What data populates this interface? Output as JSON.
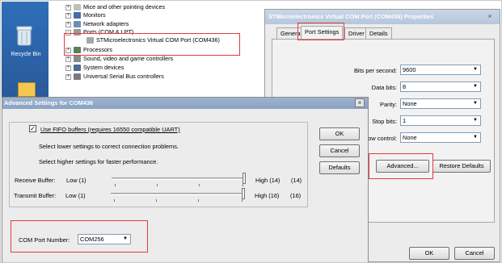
{
  "desktop": {
    "recycle_bin": "Recycle Bin"
  },
  "device_tree": {
    "items": [
      {
        "label": "Mice and other pointing devices",
        "expand": "+"
      },
      {
        "label": "Monitors",
        "expand": "+"
      },
      {
        "label": "Network adapters",
        "expand": "+"
      },
      {
        "label": "Ports (COM & LPT)",
        "expand": "-"
      },
      {
        "label": "STMicroelectronics Virtual COM Port (COM436)",
        "expand": ""
      },
      {
        "label": "Processors",
        "expand": "+"
      },
      {
        "label": "Sound, video and game controllers",
        "expand": "+"
      },
      {
        "label": "System devices",
        "expand": "+"
      },
      {
        "label": "Universal Serial Bus controllers",
        "expand": "+"
      }
    ]
  },
  "properties": {
    "title": "STMicroelectronics Virtual COM Port (COM436) Properties",
    "tabs": [
      "General",
      "Port Settings",
      "Driver",
      "Details"
    ],
    "active_tab": "Port Settings",
    "fields": [
      {
        "label": "Bits per second:",
        "value": "9600"
      },
      {
        "label": "Data bits:",
        "value": "8"
      },
      {
        "label": "Parity:",
        "value": "None"
      },
      {
        "label": "Stop bits:",
        "value": "1"
      },
      {
        "label": "Flow control:",
        "value": "None"
      }
    ],
    "advanced_button": "Advanced...",
    "restore_button": "Restore Defaults",
    "ok_button": "OK",
    "cancel_button": "Cancel"
  },
  "advanced": {
    "title": "Advanced Settings for COM436",
    "fifo_checked": true,
    "fifo_label": "Use FIFO buffers (requires 16550 compatible UART)",
    "hint1": "Select lower settings to correct connection problems.",
    "hint2": "Select higher settings for faster performance.",
    "receive": {
      "label": "Receive Buffer:",
      "low": "Low (1)",
      "high": "High (14)",
      "value": "(14)"
    },
    "transmit": {
      "label": "Transmit Buffer:",
      "low": "Low (1)",
      "high": "High (16)",
      "value": "(16)"
    },
    "ok_button": "OK",
    "cancel_button": "Cancel",
    "defaults_button": "Defaults",
    "com_port_label": "COM Port Number:",
    "com_port_value": "COM256"
  }
}
